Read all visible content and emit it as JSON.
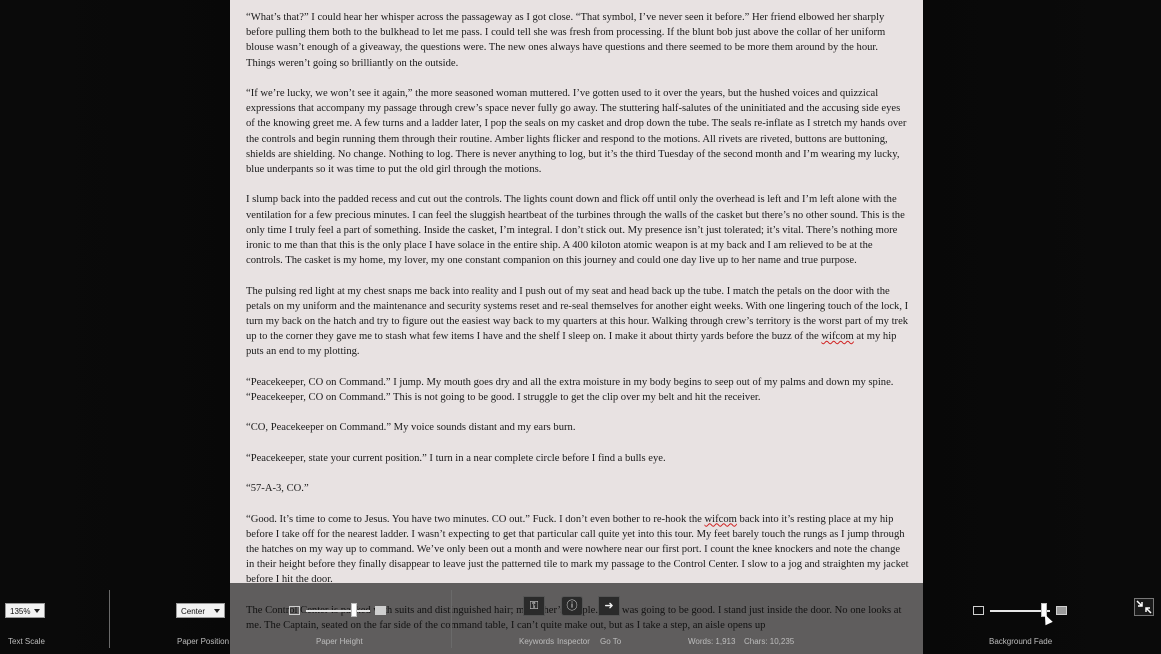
{
  "document": {
    "paragraphs": [
      {
        "parts": [
          {
            "t": "“What’s that?” I could hear her whisper across the passageway as I got close. “That symbol, I’ve never seen it before.” Her friend elbowed her sharply before pulling them both to the bulkhead to let me pass. I could tell she was fresh from processing. If the blunt bob just above the collar of her uniform blouse wasn’t enough of a giveaway, the questions were. The new ones always have questions and there seemed to be more them around by the hour. Things weren’t going so brilliantly on the outside."
          }
        ]
      },
      {
        "parts": [
          {
            "t": "“If we’re lucky, we won’t see it again,” the more seasoned woman muttered. I’ve gotten used to it over the years, but the hushed voices and quizzical expressions that accompany my passage through crew’s space never fully go away. The stuttering half-salutes of the uninitiated and the accusing side eyes of the knowing greet me. A few turns and a ladder later, I pop the seals on my casket and drop down the tube. The seals re-inflate as I stretch my hands over the controls and begin running them through their routine. Amber lights flicker and respond to the motions. All rivets are riveted, buttons are buttoning, shields are shielding. No change. Nothing to log. There is never anything to log, but it’s the third Tuesday of the second month and I’m wearing my lucky, blue underpants so it was time to put the old girl through the motions."
          }
        ]
      },
      {
        "parts": [
          {
            "t": "I slump back into the padded recess and cut out the controls. The lights count down and flick off until only the overhead is left and I’m left alone with the ventilation for a few precious minutes. I can feel the sluggish heartbeat of the turbines through the walls of the casket but there’s no other sound. This is the only time I truly feel a part of something. Inside the casket, I’m integral. I don’t stick out. My presence isn’t just tolerated; it’s vital. There’s nothing more ironic to me than that this is the only place I have solace in the entire ship. A 400 kiloton atomic weapon is at my back and I am relieved to be at the controls. The casket is my home, my lover, my one constant companion on this journey and could one day live up to her name and true purpose."
          }
        ]
      },
      {
        "parts": [
          {
            "t": "The pulsing red light at my chest snaps me back into reality and I push out of my seat and head back up the tube. I match the petals on the door with the petals on my uniform and the maintenance and security systems reset and re-seal themselves for another eight weeks. With one lingering touch of the lock, I turn my back on the hatch and try to figure out the easiest way back to my quarters at this hour. Walking through crew’s territory is the worst part of my trek up to the corner they gave me to stash what few items I have and the shelf I sleep on. I make it about thirty yards before the buzz of the "
          },
          {
            "t": "wifcom",
            "w": true
          },
          {
            "t": " at my hip puts an end to my plotting."
          }
        ]
      },
      {
        "parts": [
          {
            "t": "“Peacekeeper, CO on Command.” I jump. My mouth goes dry and all the extra moisture in my body begins to seep out of my palms and down my spine. “Peacekeeper, CO on Command.” This is not going to be good. I struggle to get the clip over my belt and hit the receiver."
          }
        ]
      },
      {
        "parts": [
          {
            "t": "“CO, Peacekeeper on Command.” My voice sounds distant and my ears burn."
          }
        ]
      },
      {
        "parts": [
          {
            "t": "“Peacekeeper, state your current position.” I turn in a near complete circle before I find a bulls eye."
          }
        ]
      },
      {
        "parts": [
          {
            "t": "“57-A-3, CO.”"
          }
        ]
      },
      {
        "parts": [
          {
            "t": "“Good. It’s time to come to Jesus. You have two minutes. CO out.” Fuck. I don’t even bother to re-hook the "
          },
          {
            "t": "wifcom",
            "w": true
          },
          {
            "t": " back into it’s resting place at my hip before I take off for the nearest ladder. I wasn’t expecting to get that particular call quite yet into this tour. My feet barely touch the rungs as I jump through the hatches on my way up to command. We’ve only been out a month and were nowhere near our first port. I count the knee knockers and note the change in their height before they finally disappear to leave just the patterned tile to mark my passage to the Control Center. I slow to a jog and straighten my jacket before I hit the door."
          }
        ]
      },
      {
        "parts": [
          {
            "t": "The Control Center is packed with suits and distinguished hair; my father’s people. This was going to be good. I stand just inside the door. No one looks at me. The Captain, seated on the far side of the command table, I can’t quite make out, but as I take a step, an aisle opens up"
          }
        ]
      }
    ]
  },
  "toolbar": {
    "text_scale": {
      "value": "135%",
      "caption": "Text Scale"
    },
    "paper_position": {
      "value": "Center",
      "caption": "Paper Position"
    },
    "paper_height": {
      "caption": "Paper Height",
      "level": 0.75
    },
    "tools": {
      "keywords": "Keywords",
      "inspector": "Inspector",
      "goto": "Go To"
    },
    "stats": {
      "words": "Words: 1,913",
      "chars": "Chars: 10,235"
    },
    "background_fade": {
      "caption": "Background Fade",
      "level": 0.9
    }
  }
}
